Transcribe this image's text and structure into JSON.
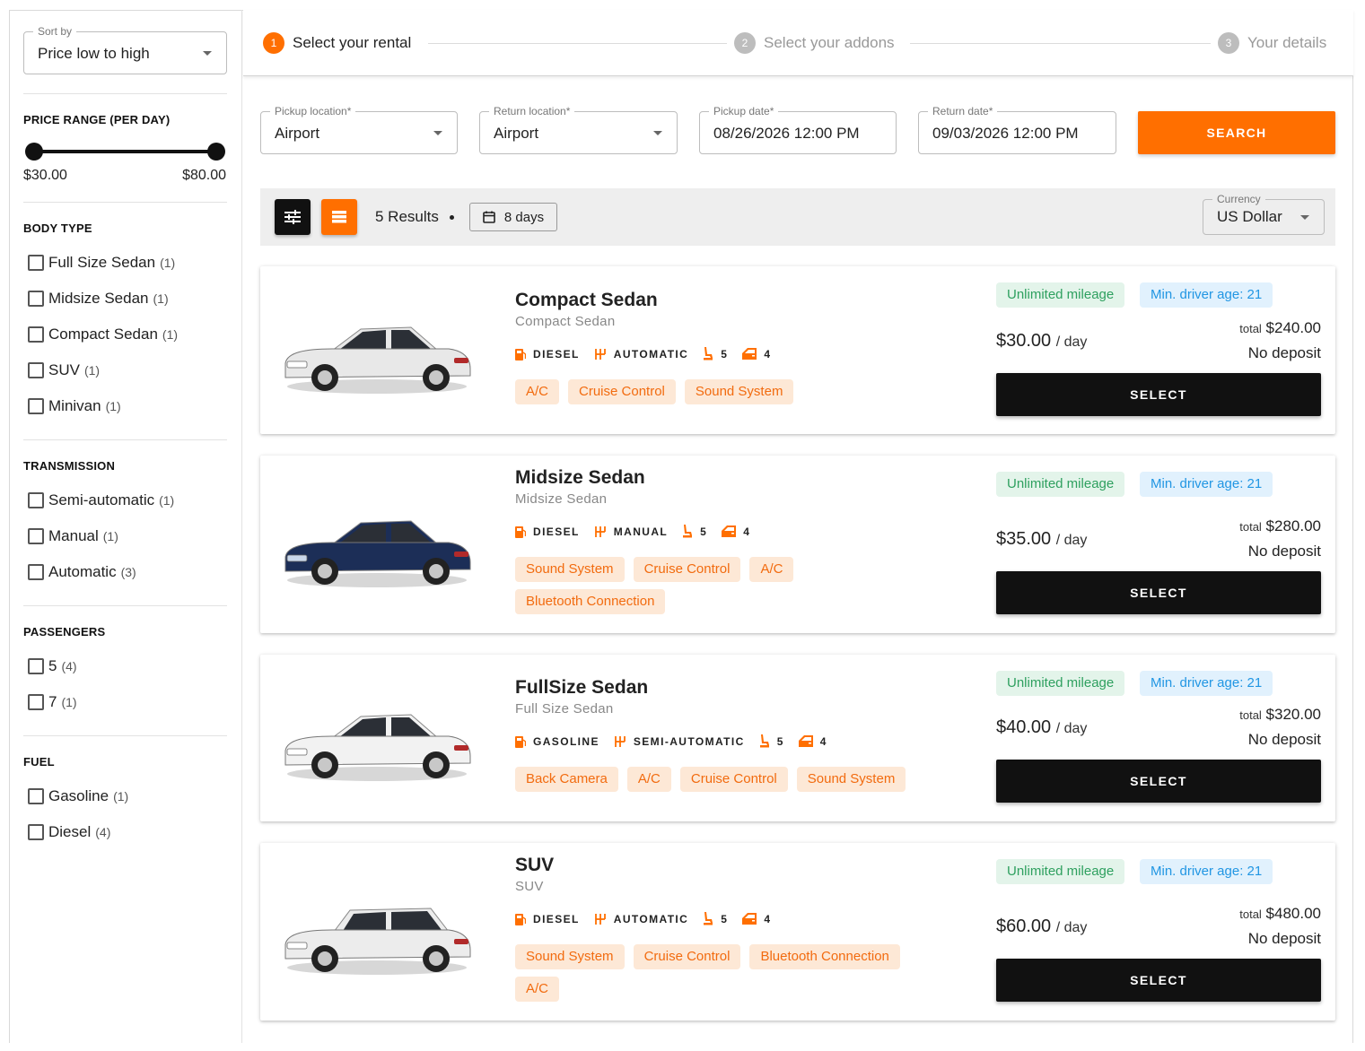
{
  "sidebar": {
    "sort": {
      "legend": "Sort by",
      "value": "Price low to high"
    },
    "price": {
      "title": "PRICE RANGE (PER DAY)",
      "min": "$30.00",
      "max": "$80.00",
      "range_fraction": [
        0.0,
        1.0
      ]
    },
    "body_type": {
      "title": "BODY TYPE",
      "items": [
        {
          "label": "Full Size Sedan",
          "count": "(1)"
        },
        {
          "label": "Midsize Sedan",
          "count": "(1)"
        },
        {
          "label": "Compact Sedan",
          "count": "(1)"
        },
        {
          "label": "SUV",
          "count": "(1)"
        },
        {
          "label": "Minivan",
          "count": "(1)"
        }
      ]
    },
    "transmission": {
      "title": "TRANSMISSION",
      "items": [
        {
          "label": "Semi-automatic",
          "count": "(1)"
        },
        {
          "label": "Manual",
          "count": "(1)"
        },
        {
          "label": "Automatic",
          "count": "(3)"
        }
      ]
    },
    "passengers": {
      "title": "PASSENGERS",
      "items": [
        {
          "label": "5",
          "count": "(4)"
        },
        {
          "label": "7",
          "count": "(1)"
        }
      ]
    },
    "fuel": {
      "title": "FUEL",
      "items": [
        {
          "label": "Gasoline",
          "count": "(1)"
        },
        {
          "label": "Diesel",
          "count": "(4)"
        }
      ]
    }
  },
  "stepper": {
    "steps": [
      {
        "num": "1",
        "label": "Select your rental",
        "active": true
      },
      {
        "num": "2",
        "label": "Select your addons",
        "active": false
      },
      {
        "num": "3",
        "label": "Your details",
        "active": false
      }
    ]
  },
  "search": {
    "pickup_location": {
      "legend": "Pickup location*",
      "value": "Airport"
    },
    "return_location": {
      "legend": "Return location*",
      "value": "Airport"
    },
    "pickup_date": {
      "legend": "Pickup date*",
      "value": "08/26/2026 12:00 PM"
    },
    "return_date": {
      "legend": "Return date*",
      "value": "09/03/2026 12:00 PM"
    },
    "button": "SEARCH"
  },
  "toolbar": {
    "results": "5 Results",
    "days": "8 days",
    "currency": {
      "legend": "Currency",
      "value": "US Dollar"
    }
  },
  "cars": [
    {
      "name": "Compact Sedan",
      "sub": "Compact Sedan",
      "fuel": "DIESEL",
      "transmission": "AUTOMATIC",
      "seats": "5",
      "doors": "4",
      "features": [
        "A/C",
        "Cruise Control",
        "Sound System"
      ],
      "badge_mileage": "Unlimited mileage",
      "badge_age": "Min. driver age: 21",
      "price": "$30.00",
      "per": "/ day",
      "total_label": "total",
      "total": "$240.00",
      "deposit": "No deposit",
      "button": "SELECT",
      "color": "#e8e8e8"
    },
    {
      "name": "Midsize Sedan",
      "sub": "Midsize Sedan",
      "fuel": "DIESEL",
      "transmission": "MANUAL",
      "seats": "5",
      "doors": "4",
      "features": [
        "Sound System",
        "Cruise Control",
        "A/C",
        "Bluetooth Connection"
      ],
      "badge_mileage": "Unlimited mileage",
      "badge_age": "Min. driver age: 21",
      "price": "$35.00",
      "per": "/ day",
      "total_label": "total",
      "total": "$280.00",
      "deposit": "No deposit",
      "button": "SELECT",
      "color": "#1c2e57"
    },
    {
      "name": "FullSize Sedan",
      "sub": "Full Size Sedan",
      "fuel": "GASOLINE",
      "transmission": "SEMI-AUTOMATIC",
      "seats": "5",
      "doors": "4",
      "features": [
        "Back Camera",
        "A/C",
        "Cruise Control",
        "Sound System"
      ],
      "badge_mileage": "Unlimited mileage",
      "badge_age": "Min. driver age: 21",
      "price": "$40.00",
      "per": "/ day",
      "total_label": "total",
      "total": "$320.00",
      "deposit": "No deposit",
      "button": "SELECT",
      "color": "#f2f2f2"
    },
    {
      "name": "SUV",
      "sub": "SUV",
      "fuel": "DIESEL",
      "transmission": "AUTOMATIC",
      "seats": "5",
      "doors": "4",
      "features": [
        "Sound System",
        "Cruise Control",
        "Bluetooth Connection",
        "A/C"
      ],
      "badge_mileage": "Unlimited mileage",
      "badge_age": "Min. driver age: 21",
      "price": "$60.00",
      "per": "/ day",
      "total_label": "total",
      "total": "$480.00",
      "deposit": "No deposit",
      "button": "SELECT",
      "color": "#ececec"
    }
  ],
  "colors": {
    "accent": "#ff6f00",
    "dark": "#111111",
    "chip_bg": "#fde8d6",
    "chip_text": "#f26b0f",
    "green_bg": "#e3f4ea",
    "green_text": "#2ea05f",
    "blue_bg": "#e1f1fd",
    "blue_text": "#2196e3"
  },
  "icons": [
    "fuel-icon",
    "gearbox-icon",
    "seat-icon",
    "door-icon",
    "filter-icon",
    "list-view-icon",
    "calendar-icon",
    "caret-down-icon"
  ]
}
